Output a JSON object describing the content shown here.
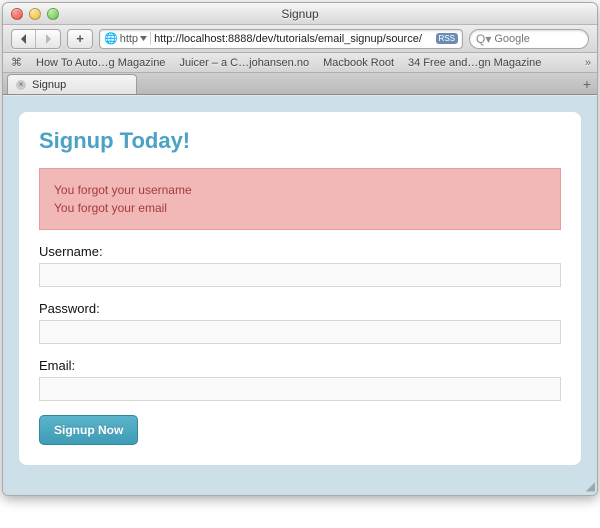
{
  "window": {
    "title": "Signup"
  },
  "toolbar": {
    "url": "http://localhost:8888/dev/tutorials/email_signup/source/",
    "scheme_label": "http",
    "search_placeholder": "Google"
  },
  "bookmarks": [
    "How To Auto…g Magazine",
    "Juicer – a C…johansen.no",
    "Macbook Root",
    "34 Free and…gn Magazine"
  ],
  "tab": {
    "label": "Signup"
  },
  "page": {
    "heading": "Signup Today!",
    "errors": [
      "You forgot your username",
      "You forgot your email"
    ],
    "labels": {
      "username": "Username:",
      "password": "Password:",
      "email": "Email:"
    },
    "values": {
      "username": "",
      "password": "",
      "email": ""
    },
    "submit_label": "Signup Now"
  }
}
